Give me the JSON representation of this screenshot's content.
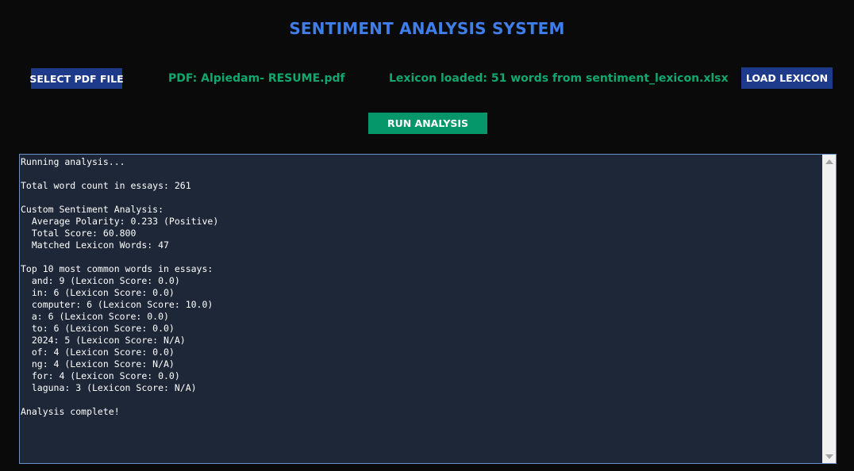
{
  "header": {
    "title": "SENTIMENT ANALYSIS SYSTEM"
  },
  "controls": {
    "select_pdf_label": "SELECT PDF FILE",
    "pdf_status": "PDF: Alpiedam- RESUME.pdf",
    "lexicon_status": "Lexicon loaded: 51 words from sentiment_lexicon.xlsx",
    "load_lexicon_label": "LOAD LEXICON",
    "run_analysis_label": "RUN ANALYSIS"
  },
  "output": {
    "lines": [
      "Running analysis...",
      "",
      "Total word count in essays: 261",
      "",
      "Custom Sentiment Analysis:",
      "  Average Polarity: 0.233 (Positive)",
      "  Total Score: 60.800",
      "  Matched Lexicon Words: 47",
      "",
      "Top 10 most common words in essays:",
      "  and: 9 (Lexicon Score: 0.0)",
      "  in: 6 (Lexicon Score: 0.0)",
      "  computer: 6 (Lexicon Score: 10.0)",
      "  a: 6 (Lexicon Score: 0.0)",
      "  to: 6 (Lexicon Score: 0.0)",
      "  2024: 5 (Lexicon Score: N/A)",
      "  of: 4 (Lexicon Score: 0.0)",
      "  ng: 4 (Lexicon Score: N/A)",
      "  for: 4 (Lexicon Score: 0.0)",
      "  laguna: 3 (Lexicon Score: N/A)",
      "",
      "Analysis complete!"
    ]
  },
  "scrollbar": {
    "up_icon": "scroll-up-arrow-icon",
    "down_icon": "scroll-down-arrow-icon"
  },
  "colors": {
    "background": "#0a0a0a",
    "title": "#3f7ee8",
    "primary_button": "#1e3a8a",
    "run_button": "#059669",
    "status_text": "#10a86e",
    "output_background": "#1e2737",
    "output_border": "#6b8fc7"
  }
}
